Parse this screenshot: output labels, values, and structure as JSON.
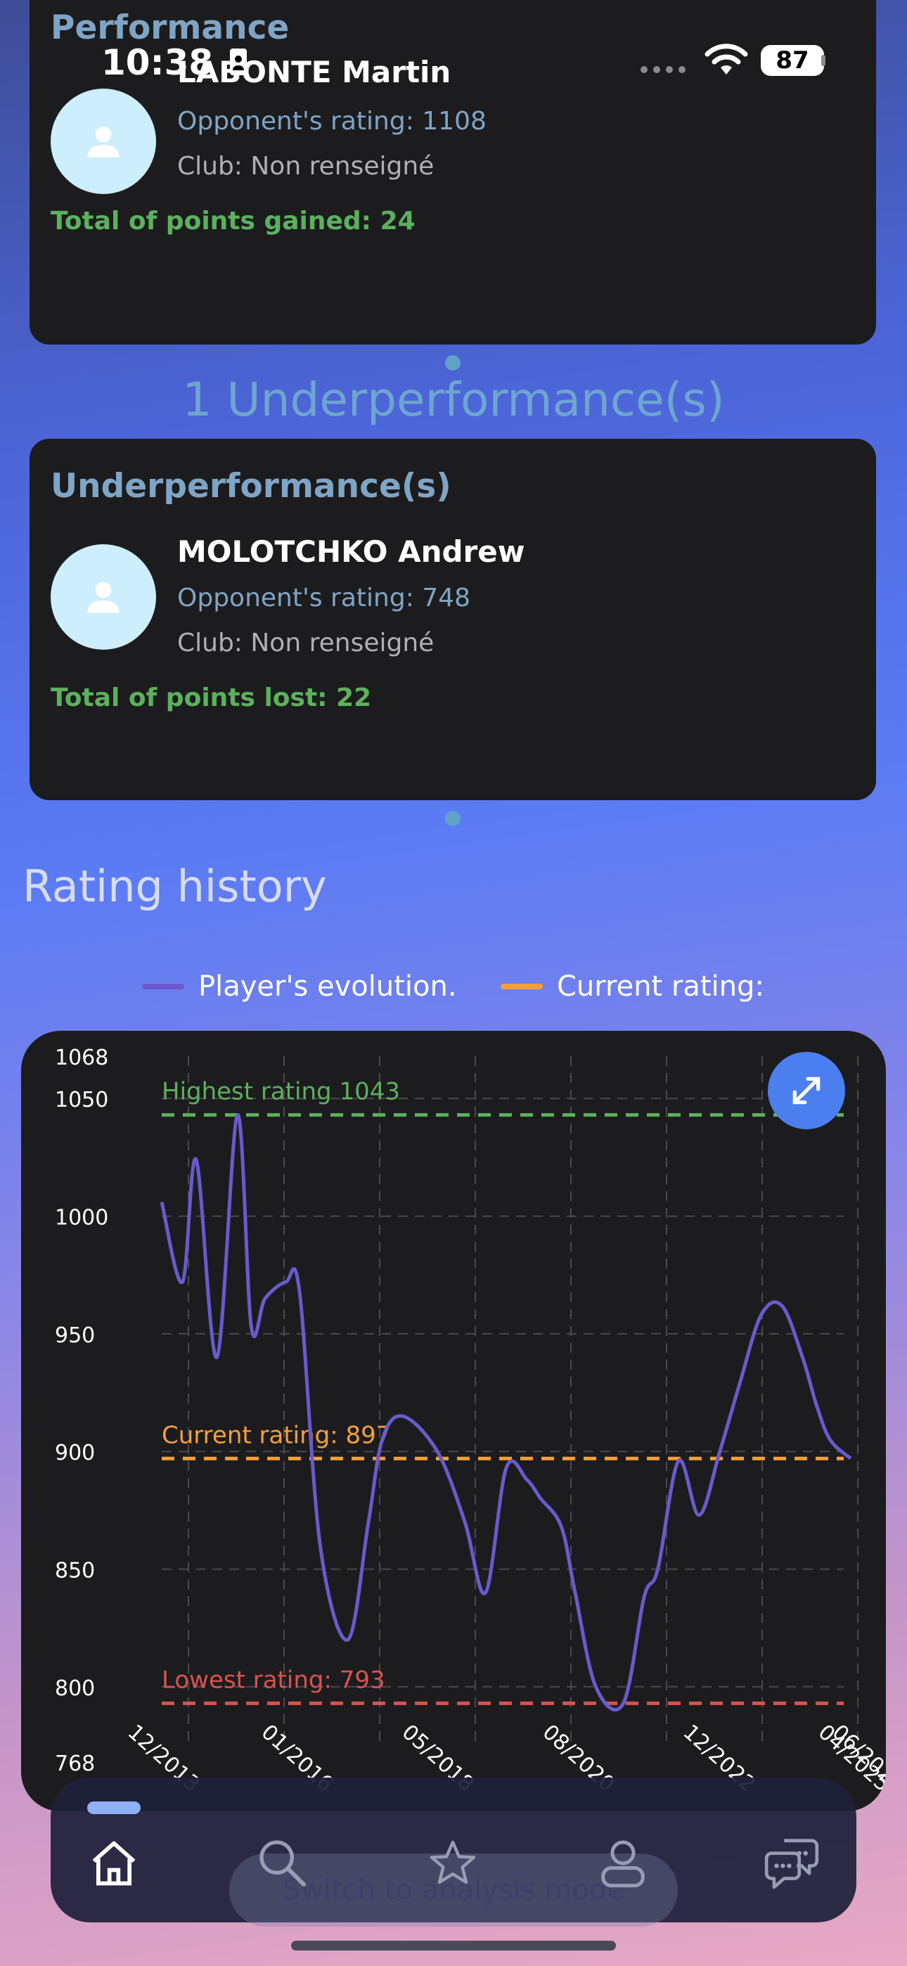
{
  "status_bar": {
    "time": "10:38",
    "battery": "87"
  },
  "performance_card": {
    "title": "Performance",
    "player_name": "LABONTE Martin",
    "opponent_rating": "Opponent's rating: 1108",
    "club": "Club: Non renseigné",
    "total": "Total of points gained: 24"
  },
  "underperformance_heading": "1 Underperformance(s)",
  "underperformance_card": {
    "title": "Underperformance(s)",
    "player_name": "MOLOTCHKO Andrew",
    "opponent_rating": "Opponent's rating: 748",
    "club": "Club: Non renseigné",
    "total": "Total of points lost: 22"
  },
  "rating_history": {
    "title": "Rating history",
    "legend": [
      {
        "label": "Player's evolution.",
        "color": "#6a5acd"
      },
      {
        "label": "Current rating:",
        "color": "#f5a03a"
      }
    ]
  },
  "chart_data": {
    "type": "line",
    "ylim": [
      768,
      1068
    ],
    "y_ticks": [
      768,
      800,
      850,
      900,
      950,
      1000,
      1050,
      1068
    ],
    "x_tick_labels": [
      "12/2013",
      "01/2016",
      "05/2018",
      "08/2020",
      "12/2022",
      "04/2025",
      "06/2025"
    ],
    "series": [
      {
        "color": "#6a5acd",
        "x": [
          0,
          0.03,
          0.05,
          0.08,
          0.11,
          0.13,
          0.15,
          0.18,
          0.2,
          0.23,
          0.27,
          0.3,
          0.32,
          0.35,
          0.4,
          0.44,
          0.47,
          0.5,
          0.53,
          0.55,
          0.58,
          0.6,
          0.63,
          0.67,
          0.7,
          0.72,
          0.75,
          0.78,
          0.81,
          0.84,
          0.87,
          0.9,
          0.93,
          0.95,
          0.97,
          1.0
        ],
        "values": [
          1006,
          972,
          1024,
          940,
          1043,
          953,
          965,
          972,
          968,
          860,
          820,
          870,
          905,
          915,
          900,
          870,
          840,
          893,
          888,
          880,
          868,
          840,
          800,
          793,
          838,
          850,
          896,
          873,
          900,
          930,
          958,
          962,
          940,
          920,
          905,
          897
        ]
      }
    ],
    "reference_lines": [
      {
        "label": "Highest rating 1043",
        "value": 1043,
        "color": "#5cb15d"
      },
      {
        "label": "Current rating: 897",
        "value": 897,
        "color": "#f5a03a"
      },
      {
        "label": "Lowest rating: 793",
        "value": 793,
        "color": "#d9534f"
      }
    ]
  },
  "bottom_nav": {
    "items": [
      {
        "name": "home",
        "active": true
      },
      {
        "name": "search",
        "active": false
      },
      {
        "name": "favorites",
        "active": false
      },
      {
        "name": "profile",
        "active": false
      },
      {
        "name": "messages",
        "active": false
      }
    ],
    "analysis_button": "Switch to analysis mode"
  }
}
